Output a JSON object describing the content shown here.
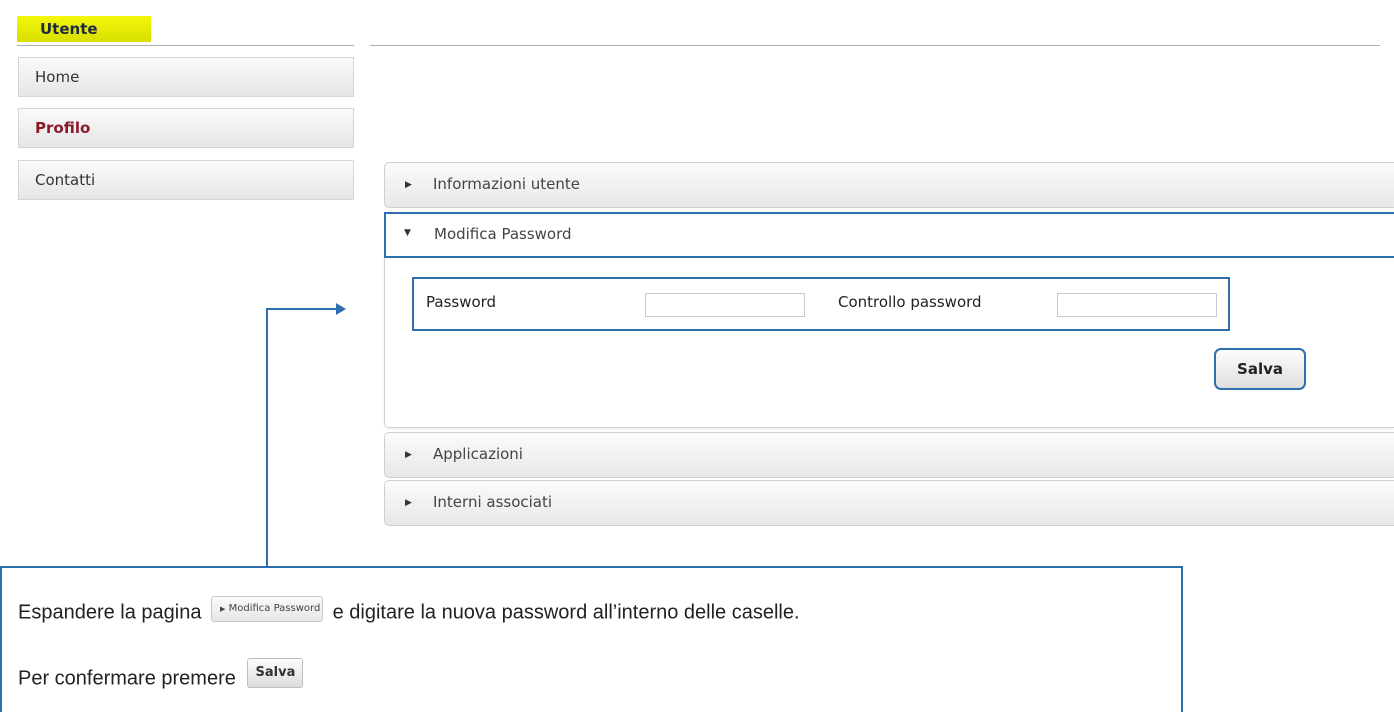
{
  "sidebar": {
    "header": "Utente",
    "items": [
      {
        "label": "Home",
        "active": false
      },
      {
        "label": "Profilo",
        "active": true
      },
      {
        "label": "Contatti",
        "active": false
      }
    ]
  },
  "accordion": {
    "sections": [
      {
        "label": "Informazioni utente",
        "expanded": false
      },
      {
        "label": "Modifica Password",
        "expanded": true
      },
      {
        "label": "Applicazioni",
        "expanded": false
      },
      {
        "label": "Interni associati",
        "expanded": false
      }
    ],
    "password_form": {
      "password_label": "Password",
      "password_value": "",
      "confirm_label": "Controllo password",
      "confirm_value": "",
      "save_label": "Salva"
    }
  },
  "icons": {
    "collapsed": "triangle-right-icon",
    "expanded": "triangle-down-icon"
  },
  "instructions": {
    "line1_before": "Espandere la pagina",
    "line1_mini_label": "Modifica Password",
    "line1_after": "e digitare la nuova password all’interno delle caselle.",
    "line2_before": "Per confermare premere",
    "line2_mini_button": "Salva"
  },
  "colors": {
    "highlight": "#2f6fad",
    "header_bg": "#f4f70a",
    "active_item": "#8b1a2b"
  }
}
